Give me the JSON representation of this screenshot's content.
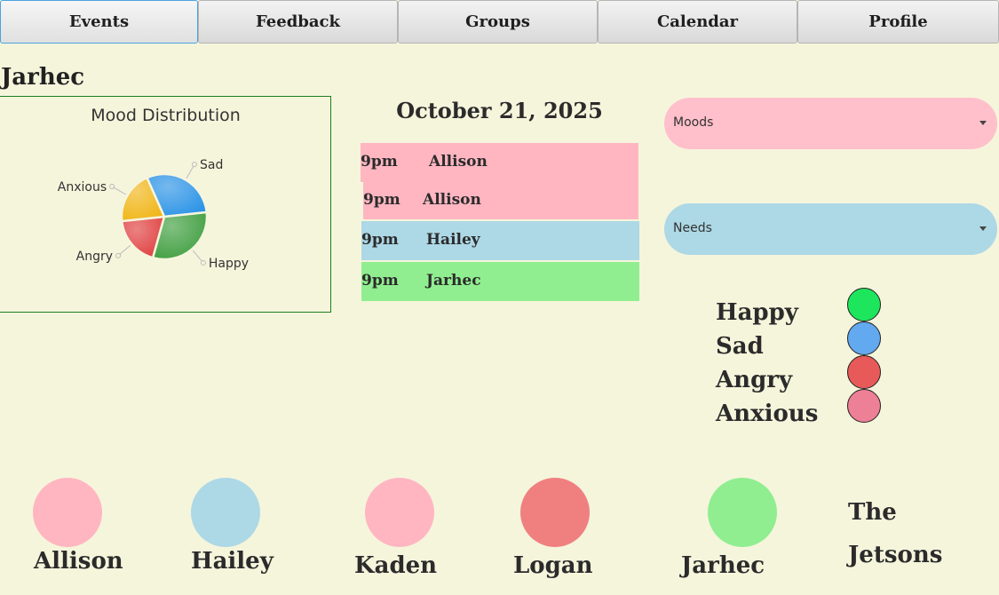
{
  "tabs": [
    {
      "label": "Events",
      "active": true
    },
    {
      "label": "Feedback",
      "active": false
    },
    {
      "label": "Groups",
      "active": false
    },
    {
      "label": "Calendar",
      "active": false
    },
    {
      "label": "Profile",
      "active": false
    }
  ],
  "user_name": "Jarhec",
  "chart_data": {
    "type": "pie",
    "title": "Mood Distribution",
    "labels": [
      "Sad",
      "Happy",
      "Angry",
      "Anxious"
    ],
    "values": [
      30,
      31,
      19,
      20
    ],
    "colors": [
      "#2b93e6",
      "#3f9e3f",
      "#e04040",
      "#f0b516"
    ]
  },
  "calendar": {
    "date": "October 21, 2025",
    "events": [
      {
        "time": "9pm",
        "name": "Allison",
        "color": "#ffb6c1"
      },
      {
        "time": "9pm",
        "name": "Allison",
        "color": "#ffb6c1"
      },
      {
        "time": "9pm",
        "name": "Hailey",
        "color": "#add8e6"
      },
      {
        "time": "9pm",
        "name": "Jarhec",
        "color": "#90ee90"
      }
    ]
  },
  "dropdowns": {
    "moods": {
      "label": "Moods",
      "color": "#ffc0cb"
    },
    "needs": {
      "label": "Needs",
      "color": "#add8e6"
    }
  },
  "mood_legend": [
    {
      "label": "Happy",
      "color": "#1ee65c"
    },
    {
      "label": "Sad",
      "color": "#63a9f0"
    },
    {
      "label": "Angry",
      "color": "#e85a5a"
    },
    {
      "label": "Anxious",
      "color": "#ee8096"
    }
  ],
  "members": [
    {
      "name": "Allison",
      "color": "#ffb6c1"
    },
    {
      "name": "Hailey",
      "color": "#add8e6"
    },
    {
      "name": "Kaden",
      "color": "#ffb6c1"
    },
    {
      "name": "Logan",
      "color": "#f08080"
    },
    {
      "name": "Jarhec",
      "color": "#90ee90"
    }
  ],
  "family": {
    "line1": "The",
    "line2": "Jetsons"
  }
}
